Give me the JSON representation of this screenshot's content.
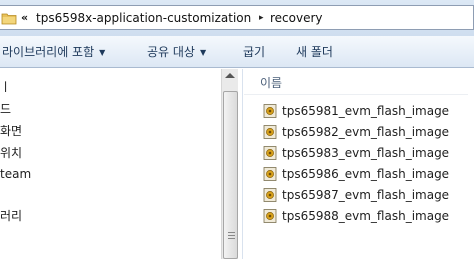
{
  "address": {
    "overflow_glyph": "«",
    "path": [
      "tps6598x-application-customization",
      "recovery"
    ],
    "separator": "▸"
  },
  "toolbar": {
    "library_label": "라이브러리에 포함",
    "share_label": "공유 대상",
    "burn_label": "굽기",
    "new_folder_label": "새 폴더",
    "dropdown_glyph": "▼"
  },
  "nav": {
    "items": [
      "ㅣ",
      "드",
      "화면",
      "위치",
      "team",
      "",
      "러리"
    ]
  },
  "file_list": {
    "column_name": "이름",
    "files": [
      "tps65981_evm_flash_image",
      "tps65982_evm_flash_image",
      "tps65983_evm_flash_image",
      "tps65986_evm_flash_image",
      "tps65987_evm_flash_image",
      "tps65988_evm_flash_image"
    ]
  },
  "colors": {
    "toolbar_text": "#1e395b",
    "header_text": "#4c607a",
    "address_border": "#8e9db3"
  },
  "icons": {
    "address": "folder-icon",
    "file": "flash-image-file-icon"
  }
}
